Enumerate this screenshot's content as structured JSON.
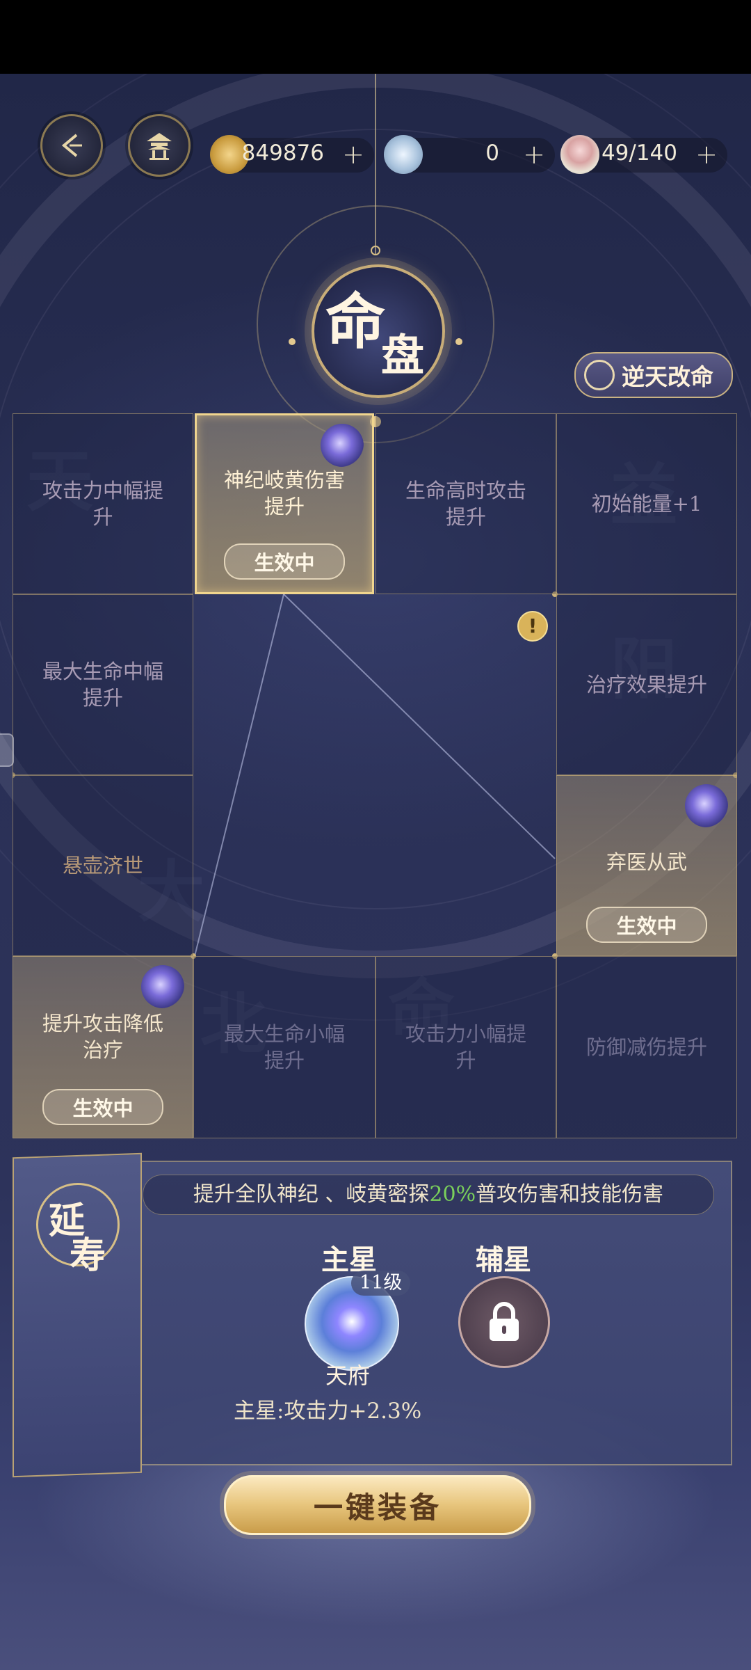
{
  "topbar": {
    "back_icon": "back-arrow-icon",
    "home_icon": "pavilion-icon",
    "currencies": [
      {
        "name": "coin",
        "value": "849876",
        "icon": "coin-icon"
      },
      {
        "name": "jade",
        "value": "0",
        "icon": "jade-icon"
      },
      {
        "name": "stamina",
        "value": "49/140",
        "icon": "bowl-icon"
      }
    ],
    "plus": "+"
  },
  "title": {
    "char1": "命",
    "char2": "盘"
  },
  "reverse_button": {
    "label": "逆天改命"
  },
  "grid": {
    "cells": [
      {
        "label": "攻击力中幅提升",
        "state": "normal"
      },
      {
        "label": "神纪岐黄伤害提升",
        "state": "selected",
        "tag": "生效中"
      },
      {
        "label": "生命高时攻击提升",
        "state": "normal"
      },
      {
        "label": "初始能量+1",
        "state": "normal"
      },
      {
        "label": "最大生命中幅提升",
        "state": "normal"
      },
      {
        "label": "治疗效果提升",
        "state": "normal"
      },
      {
        "label": "悬壶济世",
        "state": "warm"
      },
      {
        "label": "弃医从武",
        "state": "active",
        "tag": "生效中"
      },
      {
        "label": "提升攻击降低治疗",
        "state": "active",
        "tag": "生效中"
      },
      {
        "label": "最大生命小幅提升",
        "state": "dim"
      },
      {
        "label": "攻击力小幅提升",
        "state": "dim"
      },
      {
        "label": "防御减伤提升",
        "state": "dim"
      }
    ],
    "alert": "!"
  },
  "scroll": {
    "char1": "延",
    "char2": "寿"
  },
  "panel": {
    "desc_before": "提升全队神纪 、岐黄密探",
    "desc_highlight": "20%",
    "desc_after": "普攻伤害和技能伤害",
    "highlight_color": "#7ad05b",
    "main_star_title": "主星",
    "main_star_level": "11级",
    "main_star_name": "天府",
    "sub_star_title": "辅星",
    "bonus": "主星:攻击力+2.3%"
  },
  "equip_button": {
    "label": "一键装备"
  }
}
